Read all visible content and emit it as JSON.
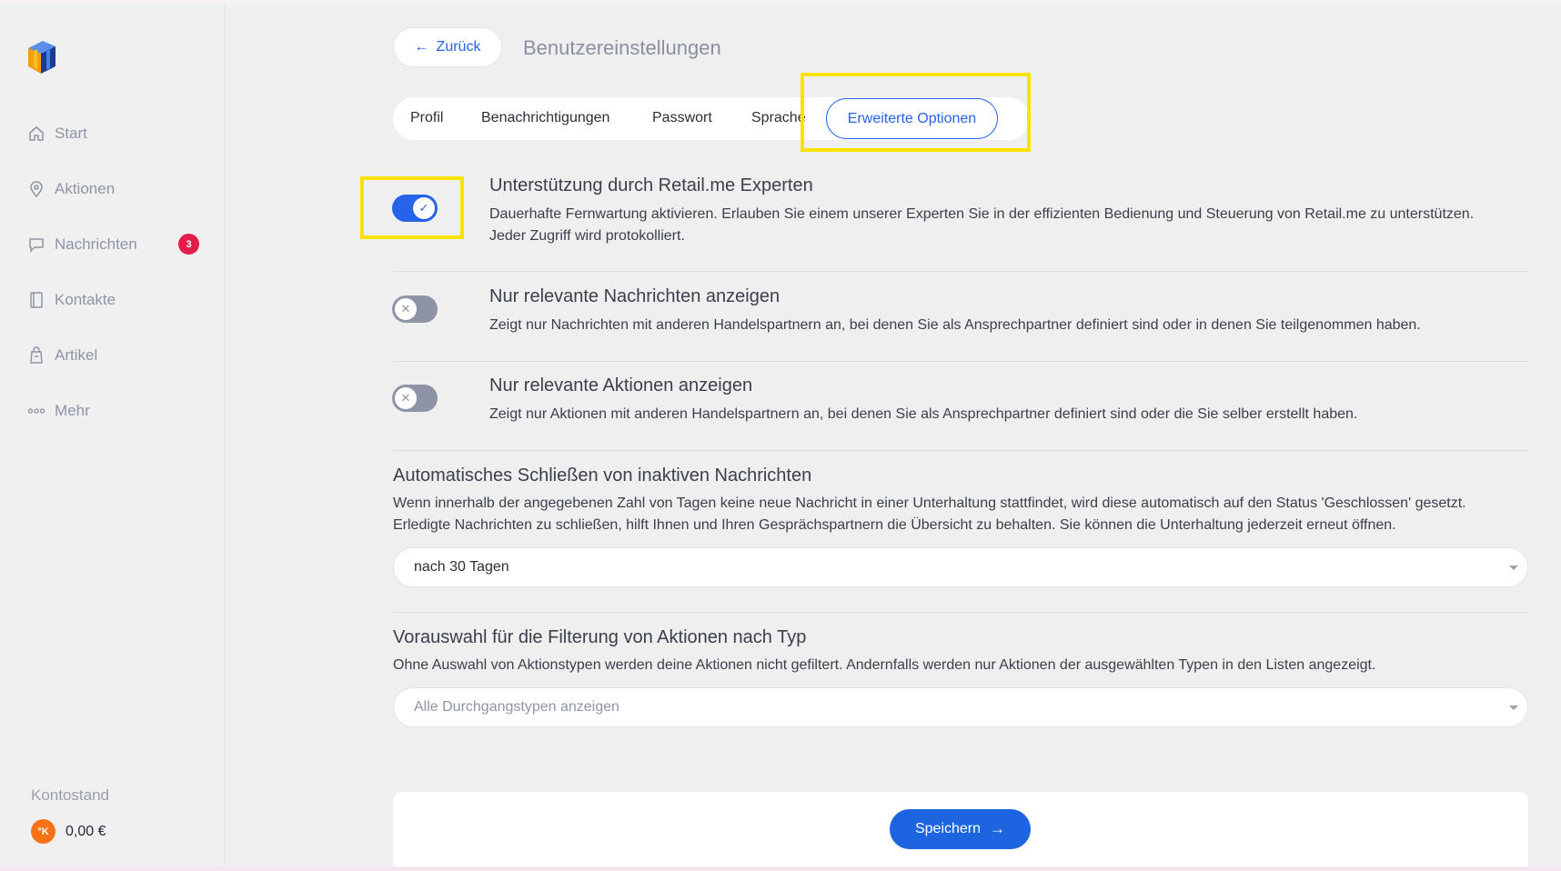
{
  "colors": {
    "accent": "#2563eb",
    "badge": "#e11d48",
    "highlight": "#f7e200",
    "coin": "#f97316"
  },
  "sidebar": {
    "items": [
      {
        "label": "Start",
        "icon": "home-icon"
      },
      {
        "label": "Aktionen",
        "icon": "location-pin-icon"
      },
      {
        "label": "Nachrichten",
        "icon": "chat-icon",
        "badge": "3"
      },
      {
        "label": "Kontakte",
        "icon": "address-book-icon"
      },
      {
        "label": "Artikel",
        "icon": "shopping-bag-icon"
      },
      {
        "label": "Mehr",
        "icon": "more-dots-icon"
      }
    ],
    "balance_label": "Kontostand",
    "balance_coin": "°K",
    "balance_value": "0,00 €"
  },
  "header": {
    "back_label": "Zurück",
    "title": "Benutzereinstellungen"
  },
  "tabs": [
    {
      "label": "Profil"
    },
    {
      "label": "Benachrichtigungen"
    },
    {
      "label": "Passwort"
    },
    {
      "label": "Sprache"
    },
    {
      "label": "Erweiterte Optionen",
      "active": true
    }
  ],
  "options": [
    {
      "title": "Unterstützung durch Retail.me Experten",
      "desc": "Dauerhafte Fernwartung aktivieren. Erlauben Sie einem unserer Experten Sie in der effizienten Bedienung und Steuerung von Retail.me zu unterstützen.",
      "desc2": "Jeder Zugriff wird protokolliert.",
      "enabled": true
    },
    {
      "title": "Nur relevante Nachrichten anzeigen",
      "desc": "Zeigt nur Nachrichten mit anderen Handelspartnern an, bei denen Sie als Ansprechpartner definiert sind oder in denen Sie teilgenommen haben.",
      "enabled": false
    },
    {
      "title": "Nur relevante Aktionen anzeigen",
      "desc": "Zeigt nur Aktionen mit anderen Handelspartnern an, bei denen Sie als Ansprechpartner definiert sind oder die Sie selber erstellt haben.",
      "enabled": false
    }
  ],
  "autoclose": {
    "title": "Automatisches Schließen von inaktiven Nachrichten",
    "desc1": "Wenn innerhalb der angegebenen Zahl von Tagen keine neue Nachricht in einer Unterhaltung stattfindet, wird diese automatisch auf den Status 'Geschlossen' gesetzt.",
    "desc2": "Erledigte Nachrichten zu schließen, hilft Ihnen und Ihren Gesprächspartnern die Übersicht zu behalten. Sie können die Unterhaltung jederzeit erneut öffnen.",
    "selected": "nach 30 Tagen"
  },
  "filter": {
    "title": "Vorauswahl für die Filterung von Aktionen nach Typ",
    "desc": "Ohne Auswahl von Aktionstypen werden deine Aktionen nicht gefiltert. Andernfalls werden nur Aktionen der ausgewählten Typen in den Listen angezeigt.",
    "placeholder": "Alle Durchgangstypen anzeigen"
  },
  "save_label": "Speichern"
}
